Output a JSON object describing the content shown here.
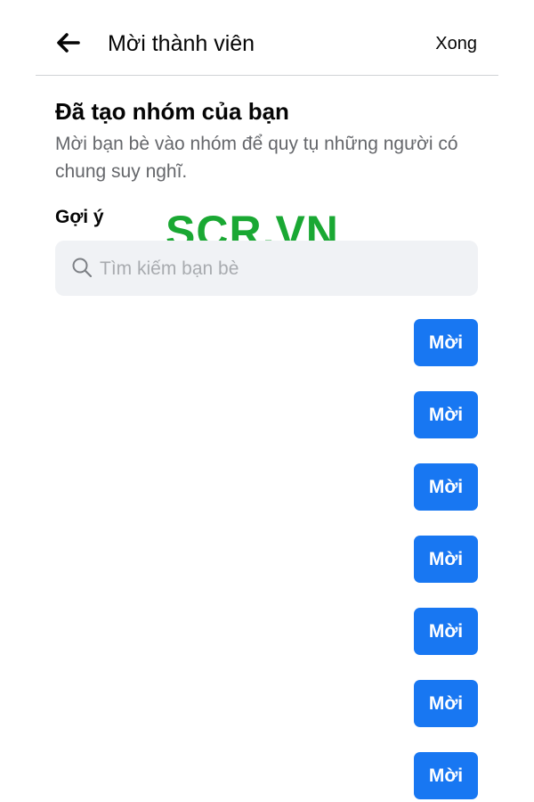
{
  "header": {
    "title": "Mời thành viên",
    "done_label": "Xong",
    "back_icon": "arrow-left-icon"
  },
  "intro": {
    "heading": "Đã tạo nhóm của bạn",
    "subtitle": "Mời bạn bè vào nhóm để quy tụ những người có chung suy nghĩ."
  },
  "suggestions": {
    "label": "Gợi ý"
  },
  "watermark": "SCR.VN",
  "search": {
    "placeholder": "Tìm kiếm bạn bè",
    "value": "",
    "icon": "search-icon"
  },
  "friends": [
    {
      "invite_label": "Mời"
    },
    {
      "invite_label": "Mời"
    },
    {
      "invite_label": "Mời"
    },
    {
      "invite_label": "Mời"
    },
    {
      "invite_label": "Mời"
    },
    {
      "invite_label": "Mời"
    },
    {
      "invite_label": "Mời"
    }
  ],
  "colors": {
    "accent": "#1877f2",
    "watermark": "#1aa833",
    "search_bg": "#f0f2f5",
    "secondary_text": "#65676b"
  }
}
